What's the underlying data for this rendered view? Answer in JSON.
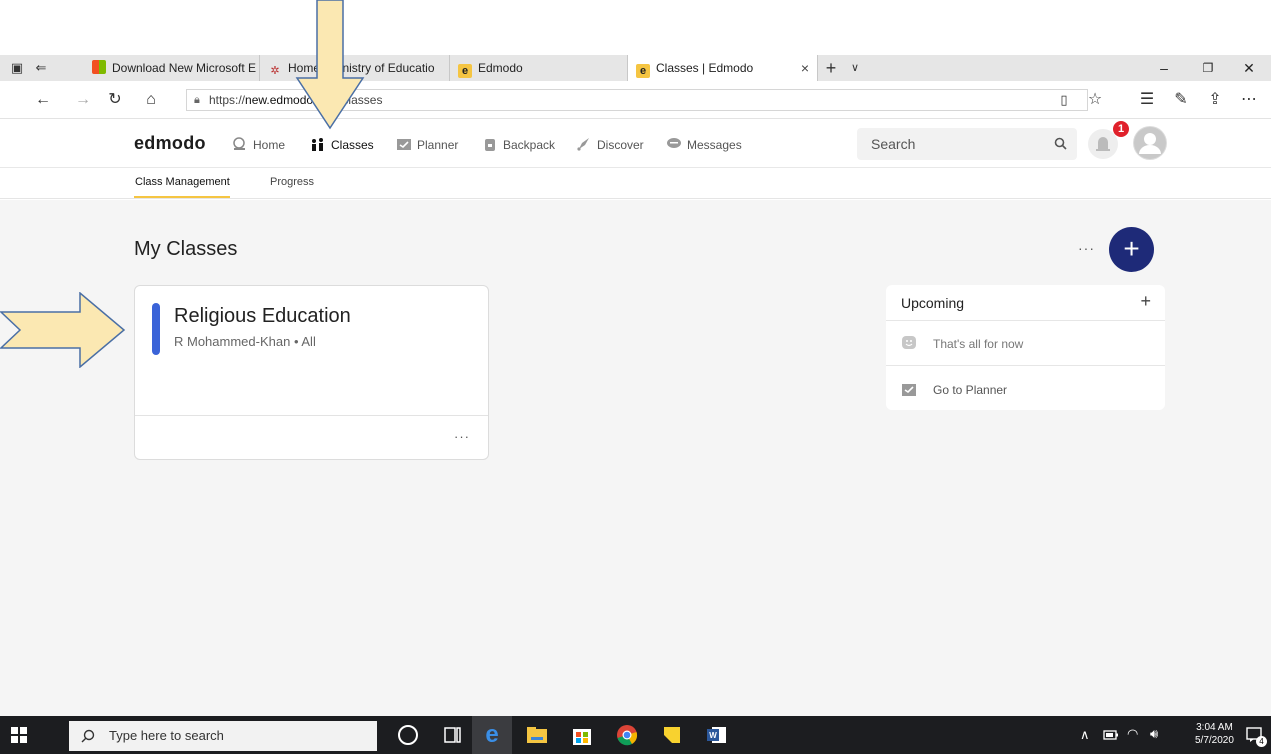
{
  "browser": {
    "tabs": [
      {
        "label": "Download New Microsoft E",
        "active": false
      },
      {
        "label": "Home | Ministry of Educatio",
        "active": false
      },
      {
        "label": "Edmodo",
        "active": false
      },
      {
        "label": "Classes | Edmodo",
        "active": true
      }
    ],
    "new_tab": "+",
    "tab_menu": "∨",
    "url_prefix": "https://",
    "url_host": "new.edmodo.com",
    "url_path": "/classes",
    "close_tab": "×",
    "window": {
      "minimize": "–",
      "restore": "❐",
      "close": "✕"
    }
  },
  "app": {
    "logo": "edmodo",
    "nav": [
      {
        "label": "Home",
        "icon": "home-icon"
      },
      {
        "label": "Classes",
        "icon": "classes-icon"
      },
      {
        "label": "Planner",
        "icon": "planner-icon"
      },
      {
        "label": "Backpack",
        "icon": "backpack-icon"
      },
      {
        "label": "Discover",
        "icon": "rocket-icon"
      },
      {
        "label": "Messages",
        "icon": "messages-icon"
      }
    ],
    "search_placeholder": "Search",
    "notification_count": "1",
    "subnav": [
      "Class Management",
      "Progress"
    ]
  },
  "main": {
    "title": "My Classes",
    "add_button": "+",
    "more": "···",
    "class_card": {
      "title": "Religious Education",
      "subtitle": "R Mohammed-Khan • All",
      "more": "···",
      "accent_color": "#3a63d8"
    },
    "upcoming": {
      "title": "Upcoming",
      "add": "+",
      "empty_text": "That's all for now",
      "planner_link": "Go to Planner"
    }
  },
  "taskbar": {
    "search_placeholder": "Type here to search",
    "time": "3:04 AM",
    "date": "5/7/2020",
    "notification_count": "4"
  }
}
